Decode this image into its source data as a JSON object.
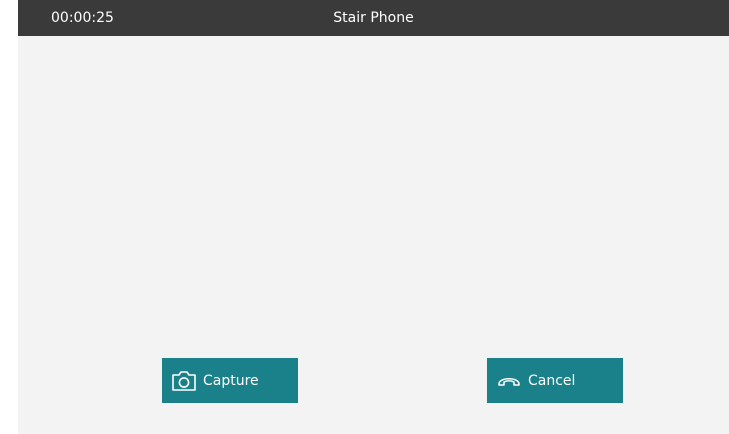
{
  "header": {
    "timer": "00:00:25",
    "title": "Stair Phone"
  },
  "actions": {
    "capture_label": "Capture",
    "cancel_label": "Cancel"
  },
  "icons": {
    "capture": "camera-icon",
    "cancel": "hang-up-icon"
  },
  "colors": {
    "titlebar": "#3a3a3a",
    "content_bg": "#f3f3f3",
    "button": "#1a818a"
  }
}
